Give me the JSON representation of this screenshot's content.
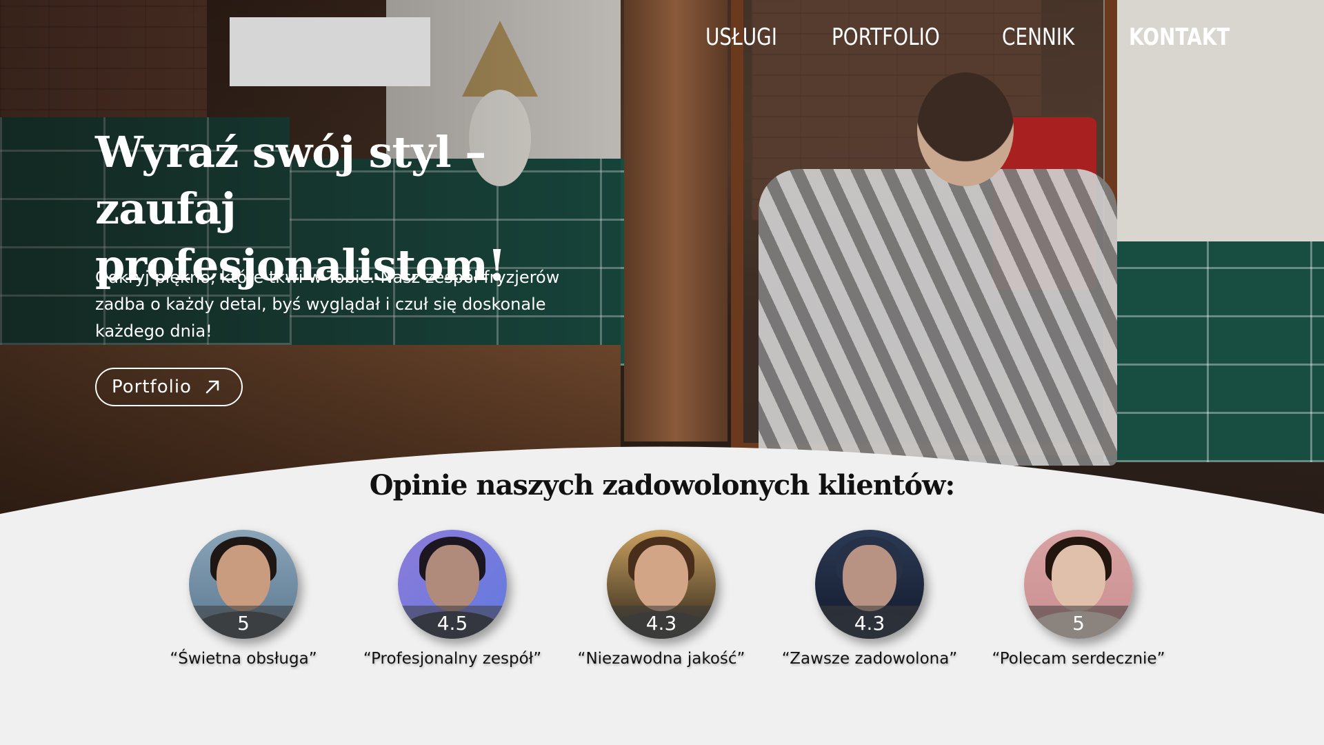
{
  "logo": {
    "icon": "logo-placeholder"
  },
  "nav": {
    "items": [
      {
        "label": "USŁUGI"
      },
      {
        "label": "PORTFOLIO"
      },
      {
        "label": "CENNIK"
      },
      {
        "label": "KONTAKT",
        "active": true
      }
    ]
  },
  "hero": {
    "headline_line1": "Wyraź swój styl – zaufaj",
    "headline_line2": "profesjonalistom!",
    "subtext": "Odkryj piękno, które tkwi w Tobie. Nasz zespół fryzjerów zadba o każdy detal, byś wyglądał i czuł się doskonale każdego dnia!",
    "cta_label": "Portfolio",
    "cta_icon": "arrow-up-right-icon"
  },
  "reviews": {
    "title": "Opinie naszych zadowolonych klientów:",
    "items": [
      {
        "rating": "5",
        "quote": "“Świetna obsługa”"
      },
      {
        "rating": "4.5",
        "quote": "“Profesjonalny zespół”"
      },
      {
        "rating": "4.3",
        "quote": "“Niezawodna jakość”"
      },
      {
        "rating": "4.3",
        "quote": "“Zawsze zadowolona”"
      },
      {
        "rating": "5",
        "quote": "“Polecam serdecznie”"
      }
    ]
  },
  "colors": {
    "background": "#f0f0f0",
    "nav_text": "#ffffff",
    "heading_text": "#111111"
  }
}
